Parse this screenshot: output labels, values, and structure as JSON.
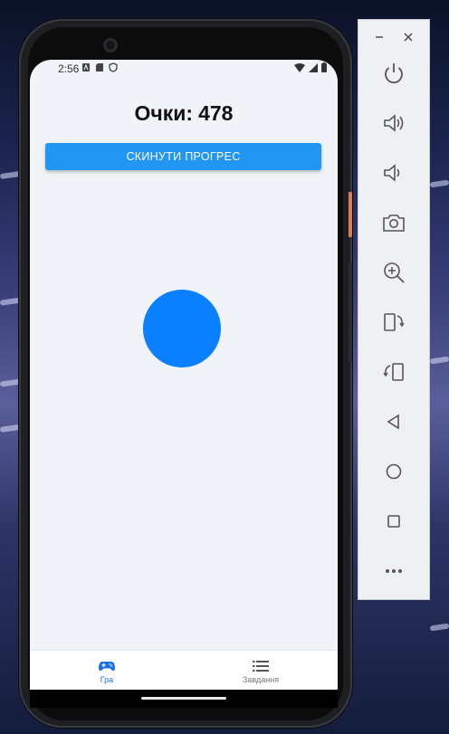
{
  "status_bar": {
    "time": "2:56"
  },
  "game": {
    "score_label": "Очки:",
    "score_value": "478",
    "reset_button_label": "СКИНУТИ ПРОГРЕС",
    "target_color": "#0a80ff"
  },
  "bottom_nav": {
    "tabs": [
      {
        "label": "Гра",
        "icon": "gamepad-icon",
        "active": true
      },
      {
        "label": "Завдання",
        "icon": "list-icon",
        "active": false
      }
    ]
  },
  "emulator_toolbar": {
    "buttons": [
      "minimize-icon",
      "close-icon",
      "power-icon",
      "volume-up-icon",
      "volume-down-icon",
      "camera-icon",
      "zoom-icon",
      "rotate-left-icon",
      "rotate-right-icon",
      "back-icon",
      "home-icon",
      "overview-icon",
      "more-icon"
    ]
  },
  "colors": {
    "accent": "#2196f3",
    "active_tab": "#1a73e8",
    "screen_bg": "#f0f3f7"
  }
}
